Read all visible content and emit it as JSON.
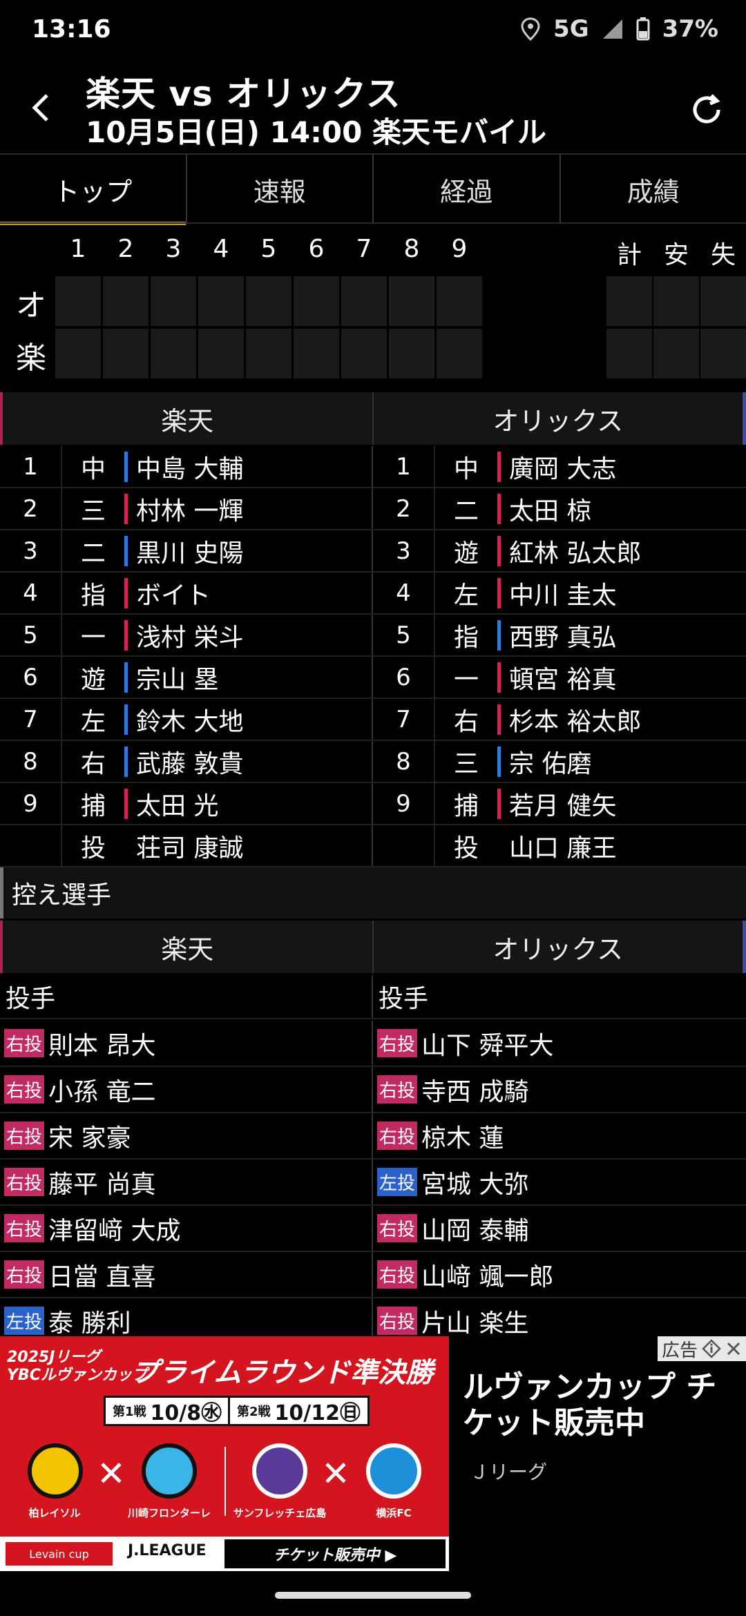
{
  "status_bar": {
    "time": "13:16",
    "network": "5G",
    "battery": "37%"
  },
  "header": {
    "title": "楽天 vs オリックス",
    "subtitle": "10月5日(日) 14:00 楽天モバイル"
  },
  "tabs": [
    {
      "label": "トップ",
      "active": true
    },
    {
      "label": "速報",
      "active": false
    },
    {
      "label": "経過",
      "active": false
    },
    {
      "label": "成績",
      "active": false
    }
  ],
  "scoreboard": {
    "innings": [
      "1",
      "2",
      "3",
      "4",
      "5",
      "6",
      "7",
      "8",
      "9"
    ],
    "totals_headers": [
      "計",
      "安",
      "失"
    ],
    "teams": [
      "オ",
      "楽"
    ]
  },
  "lineup": {
    "home_team": "楽天",
    "away_team": "オリックス",
    "rows": [
      {
        "left": {
          "order": "1",
          "pos": "中",
          "name": "中島 大輔",
          "hand": "L"
        },
        "right": {
          "order": "1",
          "pos": "中",
          "name": "廣岡 大志",
          "hand": "R"
        }
      },
      {
        "left": {
          "order": "2",
          "pos": "三",
          "name": "村林 一輝",
          "hand": "R"
        },
        "right": {
          "order": "2",
          "pos": "二",
          "name": "太田 椋",
          "hand": "R"
        }
      },
      {
        "left": {
          "order": "3",
          "pos": "二",
          "name": "黒川 史陽",
          "hand": "L"
        },
        "right": {
          "order": "3",
          "pos": "遊",
          "name": "紅林 弘太郎",
          "hand": "R"
        }
      },
      {
        "left": {
          "order": "4",
          "pos": "指",
          "name": "ボイト",
          "hand": "R"
        },
        "right": {
          "order": "4",
          "pos": "左",
          "name": "中川 圭太",
          "hand": "R"
        }
      },
      {
        "left": {
          "order": "5",
          "pos": "一",
          "name": "浅村 栄斗",
          "hand": "R"
        },
        "right": {
          "order": "5",
          "pos": "指",
          "name": "西野 真弘",
          "hand": "L"
        }
      },
      {
        "left": {
          "order": "6",
          "pos": "遊",
          "name": "宗山 塁",
          "hand": "L"
        },
        "right": {
          "order": "6",
          "pos": "一",
          "name": "頓宮 裕真",
          "hand": "R"
        }
      },
      {
        "left": {
          "order": "7",
          "pos": "左",
          "name": "鈴木 大地",
          "hand": "L"
        },
        "right": {
          "order": "7",
          "pos": "右",
          "name": "杉本 裕太郎",
          "hand": "R"
        }
      },
      {
        "left": {
          "order": "8",
          "pos": "右",
          "name": "武藤 敦貴",
          "hand": "L"
        },
        "right": {
          "order": "8",
          "pos": "三",
          "name": "宗 佑磨",
          "hand": "L"
        }
      },
      {
        "left": {
          "order": "9",
          "pos": "捕",
          "name": "太田 光",
          "hand": "R"
        },
        "right": {
          "order": "9",
          "pos": "捕",
          "name": "若月 健矢",
          "hand": "R"
        }
      },
      {
        "left": {
          "order": "",
          "pos": "投",
          "name": "荘司 康誠",
          "hand": ""
        },
        "right": {
          "order": "",
          "pos": "投",
          "name": "山口 廉王",
          "hand": ""
        }
      }
    ]
  },
  "bench": {
    "title": "控え選手",
    "home_team": "楽天",
    "away_team": "オリックス",
    "category_left": "投手",
    "category_right": "投手",
    "rows": [
      {
        "left": {
          "hand": "右投",
          "name": "則本 昂大"
        },
        "right": {
          "hand": "右投",
          "name": "山下 舜平大"
        }
      },
      {
        "left": {
          "hand": "右投",
          "name": "小孫 竜二"
        },
        "right": {
          "hand": "右投",
          "name": "寺西 成騎"
        }
      },
      {
        "left": {
          "hand": "右投",
          "name": "宋 家豪"
        },
        "right": {
          "hand": "右投",
          "name": "椋木 蓮"
        }
      },
      {
        "left": {
          "hand": "右投",
          "name": "藤平 尚真"
        },
        "right": {
          "hand": "左投",
          "name": "宮城 大弥"
        }
      },
      {
        "left": {
          "hand": "右投",
          "name": "津留﨑 大成"
        },
        "right": {
          "hand": "右投",
          "name": "山岡 泰輔"
        }
      },
      {
        "left": {
          "hand": "右投",
          "name": "日當 直喜"
        },
        "right": {
          "hand": "右投",
          "name": "山﨑 颯一郎"
        }
      },
      {
        "left": {
          "hand": "左投",
          "name": "泰 勝利"
        },
        "right": {
          "hand": "右投",
          "name": "片山 楽生"
        }
      }
    ]
  },
  "ad": {
    "label": "広告",
    "banner_top": "2025Jリーグ\nYBCルヴァンカップ",
    "banner_title": "プライムラウンド準決勝",
    "date1_tag": "第1戦",
    "date1": "10/8㊌",
    "date2_tag": "第2戦",
    "date2": "10/12㊐",
    "teams": [
      "柏レイソル",
      "川崎フロンターレ",
      "サンフレッチェ広島",
      "横浜FC"
    ],
    "cup_badge": "Levain cup",
    "league": "J.LEAGUE",
    "ticket": "チケット販売中 ▶",
    "headline": "ルヴァンカップ チケット販売中",
    "sponsor": "Ｊリーグ"
  }
}
